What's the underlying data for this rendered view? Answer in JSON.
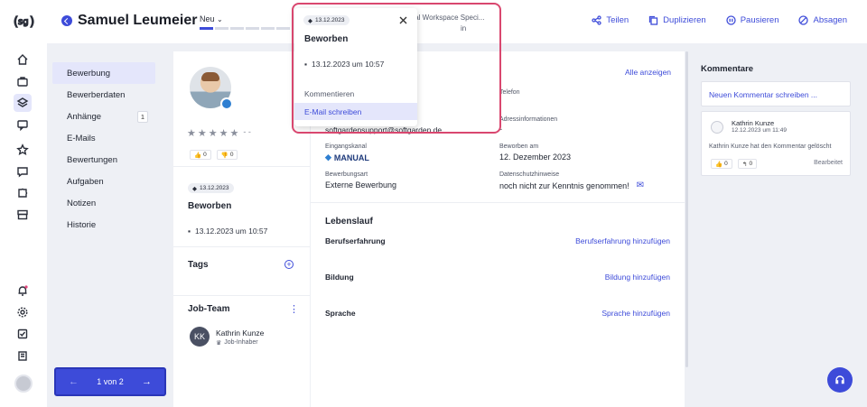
{
  "header": {
    "candidate_name": "Samuel Leumeier",
    "status_label": "Neu",
    "job_title_partial": "tal Workspace Speci...",
    "job_location_partial": "in",
    "actions": {
      "share": "Teilen",
      "duplicate": "Duplizieren",
      "pause": "Pausieren",
      "cancel": "Absagen"
    }
  },
  "nav": {
    "items": [
      {
        "label": "Bewerbung",
        "badge": ""
      },
      {
        "label": "Bewerberdaten",
        "badge": ""
      },
      {
        "label": "Anhänge",
        "badge": "1"
      },
      {
        "label": "E-Mails",
        "badge": ""
      },
      {
        "label": "Bewertungen",
        "badge": ""
      },
      {
        "label": "Aufgaben",
        "badge": ""
      },
      {
        "label": "Notizen",
        "badge": ""
      },
      {
        "label": "Historie",
        "badge": ""
      }
    ],
    "pager": "1 von 2"
  },
  "profile": {
    "rating_dash": "- -",
    "thumbs_up": "0",
    "thumbs_down": "0",
    "applied_pill": "13.12.2023",
    "applied_title": "Beworben",
    "applied_datetime": "13.12.2023 um 10:57",
    "tags_title": "Tags",
    "job_team_title": "Job-Team",
    "team_member_initials": "KK",
    "team_member_name": "Kathrin Kunze",
    "team_member_role": "Job-Inhaber"
  },
  "main": {
    "show_all": "Alle anzeigen",
    "phone_label": "Telefon",
    "address_label": "Adressinformationen",
    "address_value": "-",
    "email_partial": "softgardensupport@softgarden.de",
    "channel_label": "Eingangskanal",
    "channel_value": "MANUAL",
    "applied_on_label": "Beworben am",
    "applied_on_value": "12. Dezember 2023",
    "application_type_label": "Bewerbungsart",
    "application_type_value": "Externe Bewerbung",
    "privacy_label": "Datenschutzhinweise",
    "privacy_value": "noch nicht zur Kenntnis genommen!",
    "cv_title": "Lebenslauf",
    "cv_rows": [
      {
        "label": "Berufserfahrung",
        "action": "Berufserfahrung hinzufügen"
      },
      {
        "label": "Bildung",
        "action": "Bildung hinzufügen"
      },
      {
        "label": "Sprache",
        "action": "Sprache hinzufügen"
      }
    ]
  },
  "comments": {
    "title": "Kommentare",
    "new_placeholder": "Neuen Kommentar schreiben ...",
    "card": {
      "author": "Kathrin Kunze",
      "datetime": "12.12.2023 um 11:49",
      "text": "Kathrin Kunze hat den Kommentar gelöscht",
      "thumbs_up": "0",
      "replies": "0",
      "edited": "Bearbeitet"
    }
  },
  "popup": {
    "date_pill": "13.12.2023",
    "title": "Beworben",
    "datetime": "13.12.2023 um 10:57",
    "section": "Kommentieren",
    "menu_item": "E-Mail schreiben"
  },
  "colors": {
    "accent": "#3d4bd9",
    "highlight_border": "#d9476f",
    "background": "#eef0f5",
    "active_bg": "#e4e6fb"
  }
}
